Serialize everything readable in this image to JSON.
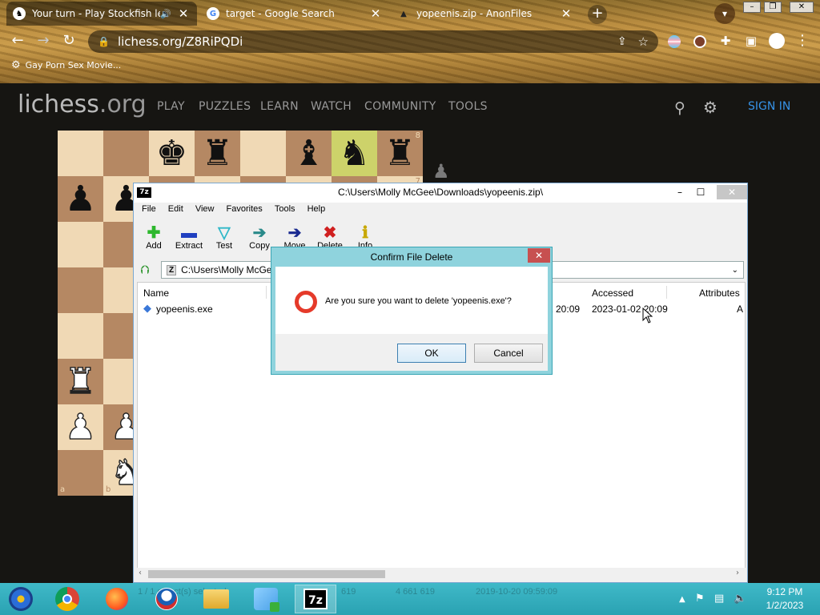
{
  "browser": {
    "tabs": [
      {
        "title": "Your turn - Play Stockfish lev",
        "active": true
      },
      {
        "title": "target - Google Search",
        "active": false
      },
      {
        "title": "yopeenis.zip - AnonFiles",
        "active": false
      }
    ],
    "url": "lichess.org/Z8RiPQDi",
    "bookmark": "Gay Porn Sex Movie..."
  },
  "lichess": {
    "logo_main": "lichess",
    "logo_tld": ".org",
    "nav": [
      "PLAY",
      "PUZZLES",
      "LEARN",
      "WATCH",
      "COMMUNITY",
      "TOOLS"
    ],
    "signin": "SIGN IN",
    "rank8_label": "8",
    "rank7_label": "7",
    "file_a_label": "a",
    "file_b_label": "b"
  },
  "sevenzip": {
    "title": "C:\\Users\\Molly McGee\\Downloads\\yopeenis.zip\\",
    "menu": [
      "File",
      "Edit",
      "View",
      "Favorites",
      "Tools",
      "Help"
    ],
    "tools": [
      {
        "label": "Add",
        "icon": "add-icon"
      },
      {
        "label": "Extract",
        "icon": "extract-icon"
      },
      {
        "label": "Test",
        "icon": "test-icon"
      },
      {
        "label": "Copy",
        "icon": "copy-icon"
      },
      {
        "label": "Move",
        "icon": "move-icon"
      },
      {
        "label": "Delete",
        "icon": "delete-icon"
      },
      {
        "label": "Info",
        "icon": "info-icon"
      }
    ],
    "path": "C:\\Users\\Molly McGee\\Downloads\\yopeenis.zip\\",
    "columns": {
      "name": "Name",
      "accessed": "Accessed",
      "attributes": "Attributes"
    },
    "row": {
      "name": "yopeenis.exe",
      "modified_partial": "2 20:09",
      "accessed": "2023-01-02 20:09",
      "attributes": "A"
    },
    "status_partial": {
      "sel": "1 / 1 object(s) selected",
      "size1": "619",
      "size2": "4 661 619",
      "date": "2019-10-20 09:59:09"
    }
  },
  "dialog": {
    "title": "Confirm File Delete",
    "message": "Are you sure you want to delete 'yopeenis.exe'?",
    "ok": "OK",
    "cancel": "Cancel"
  },
  "taskbar": {
    "time": "9:12 PM",
    "date": "1/2/2023",
    "apps": [
      "media-player",
      "chrome",
      "firefox",
      "obama-app",
      "file-explorer",
      "network-app",
      "7zip"
    ]
  }
}
